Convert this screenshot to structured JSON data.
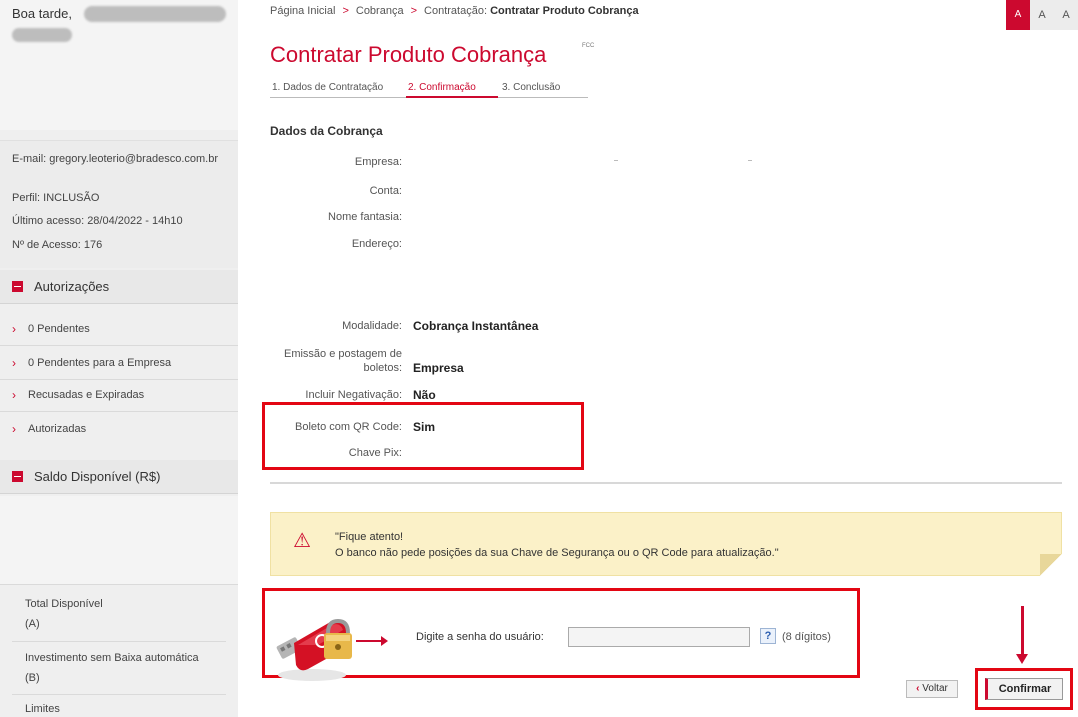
{
  "sidebar": {
    "greeting": "Boa tarde,",
    "email": "E-mail: gregory.leoterio@bradesco.com.br",
    "perfil": "Perfil: INCLUSÃO",
    "ultimo_acesso": "Último acesso: 28/04/2022 - 14h10",
    "n_acesso": "Nº de Acesso: 176",
    "autorizacoes": {
      "title": "Autorizações",
      "items": [
        {
          "label": "0 Pendentes"
        },
        {
          "label": "0 Pendentes para a Empresa"
        },
        {
          "label": "Recusadas e Expiradas"
        },
        {
          "label": "Autorizadas"
        }
      ]
    },
    "saldo": {
      "title": "Saldo Disponível (R$)",
      "items": [
        {
          "line1": "Total Disponível",
          "line2": "(A)"
        },
        {
          "line1": "Investimento sem Baixa automática",
          "line2": "(B)"
        },
        {
          "line1": "Limites",
          "line2": ""
        }
      ]
    }
  },
  "breadcrumb": {
    "home": "Página Inicial",
    "sep": ">",
    "level2": "Cobrança",
    "level3_prefix": "Contratação:",
    "level3_current": "Contratar Produto Cobrança"
  },
  "font_size": [
    "A",
    "A",
    "A"
  ],
  "page": {
    "title": "Contratar Produto Cobrança",
    "title_sup": "FCC",
    "steps": [
      "1. Dados de Contratação",
      "2. Confirmação",
      "3. Conclusão"
    ],
    "section_title": "Dados da Cobrança"
  },
  "fields": {
    "empresa": {
      "label": "Empresa:",
      "value": ""
    },
    "conta": {
      "label": "Conta:",
      "value": ""
    },
    "nome_fantasia": {
      "label": "Nome fantasia:",
      "value": ""
    },
    "endereco": {
      "label": "Endereço:",
      "value": ""
    },
    "modalidade": {
      "label": "Modalidade:",
      "value": "Cobrança Instantânea"
    },
    "emissao": {
      "label_line1": "Emissão e postagem de",
      "label_line2": "boletos:",
      "value": "Empresa"
    },
    "negativacao": {
      "label": "Incluir Negativação:",
      "value": "Não"
    },
    "qrcode": {
      "label": "Boleto com QR Code:",
      "value": "Sim"
    },
    "chave_pix": {
      "label": "Chave Pix:",
      "value": ""
    }
  },
  "warning": {
    "line1": "\"Fique atento!",
    "line2": "O banco não pede posições da sua Chave de Segurança ou o QR Code para atualização.\""
  },
  "senha": {
    "label": "Digite a senha do usuário:",
    "value": "",
    "help": "?",
    "hint": "(8 dígitos)"
  },
  "buttons": {
    "voltar": "Voltar",
    "confirmar": "Confirmar"
  },
  "colors": {
    "brand": "#cc092f",
    "highlight": "#e30613",
    "warning_bg": "#fbf1c8"
  }
}
